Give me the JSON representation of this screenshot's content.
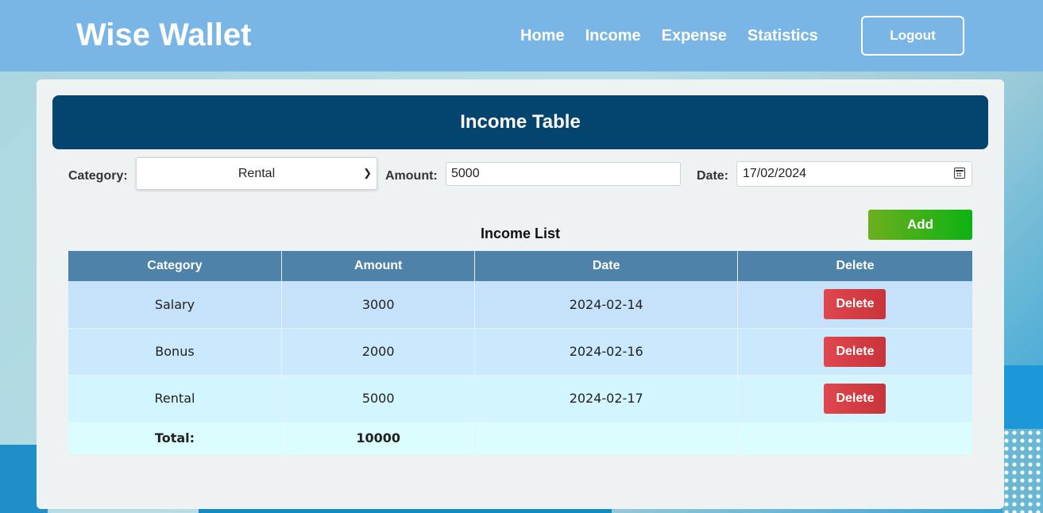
{
  "header": {
    "brand": "Wise Wallet",
    "nav": [
      "Home",
      "Income",
      "Expense",
      "Statistics"
    ],
    "logout_label": "Logout"
  },
  "panel": {
    "title": "Income Table",
    "form": {
      "category_label": "Category:",
      "category_value": "Rental",
      "amount_label": "Amount:",
      "amount_value": "5000",
      "date_label": "Date:",
      "date_value": "17/02/2024",
      "add_label": "Add"
    },
    "list_title": "Income List",
    "table": {
      "headers": [
        "Category",
        "Amount",
        "Date",
        "Delete"
      ],
      "rows": [
        {
          "category": "Salary",
          "amount": "3000",
          "date": "2024-02-14",
          "action": "Delete"
        },
        {
          "category": "Bonus",
          "amount": "2000",
          "date": "2024-02-16",
          "action": "Delete"
        },
        {
          "category": "Rental",
          "amount": "5000",
          "date": "2024-02-17",
          "action": "Delete"
        }
      ],
      "total_label": "Total:",
      "total_value": "10000"
    }
  },
  "colors": {
    "header_bg": "#79b6e6",
    "title_bar_bg": "#044570",
    "table_header_bg": "#4f82a8",
    "add_button": "#0cb313",
    "delete_button": "#d13c44"
  },
  "icons": [
    "chevron-down-icon",
    "calendar-icon"
  ]
}
